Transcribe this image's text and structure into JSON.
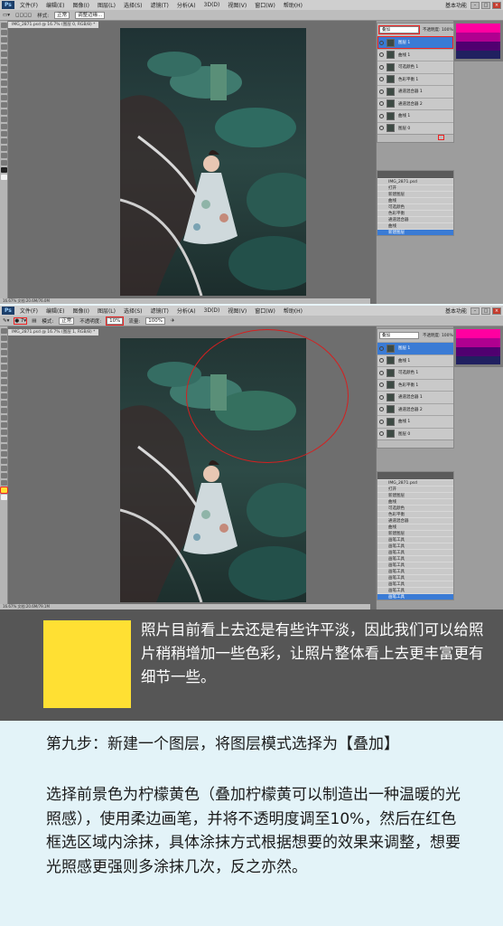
{
  "screenshot1": {
    "menu": [
      "Ps",
      "文件(F)",
      "编辑(E)",
      "图像(I)",
      "图层(L)",
      "选择(S)",
      "滤镜(T)",
      "分析(A)",
      "3D(D)",
      "视图(V)",
      "窗口(W)",
      "帮助(H)"
    ],
    "workspace_label": "基本功能",
    "options": {
      "tool_label": "调整边缘...",
      "mode": "正常",
      "mode_label": "样式:"
    },
    "doc_tab": "IMG_2871.psd @ 16.7% (图层 0, RGB/8) *",
    "status": "16.67%   文档:20.6M/76.0M",
    "layers": {
      "blend_mode": "叠加",
      "opacity_label": "不透明度: 100%",
      "rows": [
        {
          "name": "图层 1",
          "selected": true
        },
        {
          "name": "曲线 1"
        },
        {
          "name": "可选颜色 1"
        },
        {
          "name": "色彩平衡 1"
        },
        {
          "name": "通道混合器 1"
        },
        {
          "name": "通道混合器 2"
        },
        {
          "name": "曲线 1"
        },
        {
          "name": "图层 0"
        }
      ]
    },
    "history": {
      "file": "IMG_2871.psd",
      "rows": [
        "打开",
        "新建图层",
        "曲线",
        "可选颜色",
        "色彩平衡",
        "通道混合器",
        "曲线",
        "新建图层"
      ]
    }
  },
  "screenshot2": {
    "options": {
      "mode_label": "模式:",
      "mode": "正常",
      "opacity_label": "不透明度:",
      "opacity": "10%",
      "flow_label": "流量:",
      "flow": "100%"
    },
    "doc_tab": "IMG_2871.psd @ 16.7% (图层 1, RGB/8) *",
    "status": "16.67%   文档:20.6M/79.1M",
    "layers": {
      "blend_mode": "叠加",
      "opacity_label": "不透明度: 100%",
      "rows": [
        {
          "name": "图层 1",
          "selected": true
        },
        {
          "name": "曲线 1"
        },
        {
          "name": "可选颜色 1"
        },
        {
          "name": "色彩平衡 1"
        },
        {
          "name": "通道混合器 1"
        },
        {
          "name": "通道混合器 2"
        },
        {
          "name": "曲线 1"
        },
        {
          "name": "图层 0"
        }
      ]
    },
    "history": {
      "file": "IMG_2871.psd",
      "rows": [
        "打开",
        "新建图层",
        "曲线",
        "可选颜色",
        "色彩平衡",
        "通道混合器",
        "曲线",
        "新建图层",
        "画笔工具",
        "画笔工具",
        "画笔工具",
        "画笔工具",
        "画笔工具",
        "画笔工具",
        "画笔工具",
        "画笔工具",
        "画笔工具",
        "画笔工具"
      ]
    }
  },
  "colors": {
    "highlight_red": "#d42020",
    "lemon_yellow": "#ffe033",
    "tip_background": "#565656",
    "step_background": "#e3f3f8"
  },
  "tip": {
    "text": "照片目前看上去还是有些许平淡，因此我们可以给照片稍稍增加一些色彩，让照片整体看上去更丰富更有细节一些。"
  },
  "step": {
    "title": "第九步：新建一个图层，将图层模式选择为【叠加】",
    "body": "选择前景色为柠檬黄色（叠加柠檬黄可以制造出一种温暖的光照感），使用柔边画笔，并将不透明度调至10%，然后在红色框选区域内涂抹，具体涂抹方式根据想要的效果来调整，想要光照感更强则多涂抹几次，反之亦然。"
  }
}
